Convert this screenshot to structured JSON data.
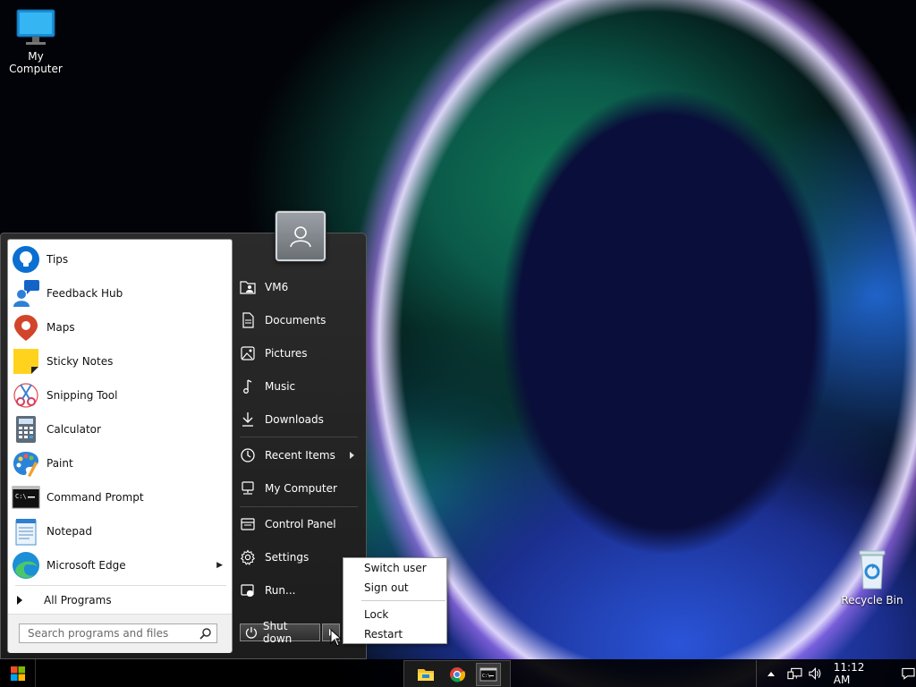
{
  "desktop": {
    "icons": [
      {
        "label": "My Computer"
      },
      {
        "label": "Recycle Bin"
      }
    ]
  },
  "start_menu": {
    "apps": [
      {
        "label": "Tips",
        "icon": "lightbulb-icon"
      },
      {
        "label": "Feedback Hub",
        "icon": "feedback-hub-icon"
      },
      {
        "label": "Maps",
        "icon": "map-pin-icon"
      },
      {
        "label": "Sticky Notes",
        "icon": "sticky-note-icon"
      },
      {
        "label": "Snipping Tool",
        "icon": "scissors-icon"
      },
      {
        "label": "Calculator",
        "icon": "calculator-icon"
      },
      {
        "label": "Paint",
        "icon": "paint-palette-icon"
      },
      {
        "label": "Command Prompt",
        "icon": "terminal-icon"
      },
      {
        "label": "Notepad",
        "icon": "notepad-icon"
      },
      {
        "label": "Microsoft Edge",
        "icon": "edge-browser-icon"
      }
    ],
    "all_programs": "All Programs",
    "search": {
      "placeholder": "Search programs and files"
    },
    "right_items": [
      {
        "label": "VM6",
        "icon": "user-folder-icon"
      },
      {
        "label": "Documents",
        "icon": "document-icon"
      },
      {
        "label": "Pictures",
        "icon": "picture-icon"
      },
      {
        "label": "Music",
        "icon": "music-note-icon"
      },
      {
        "label": "Downloads",
        "icon": "download-icon"
      },
      {
        "label": "Recent Items",
        "icon": "clock-icon"
      },
      {
        "label": "My Computer",
        "icon": "computer-icon"
      },
      {
        "label": "Control Panel",
        "icon": "control-panel-icon"
      },
      {
        "label": "Settings",
        "icon": "gear-icon"
      },
      {
        "label": "Run...",
        "icon": "run-icon"
      }
    ],
    "shutdown_label": "Shut down"
  },
  "power_menu": {
    "items": [
      "Switch user",
      "Sign out",
      "Lock",
      "Restart"
    ]
  },
  "taskbar": {
    "clock": "11:12 AM"
  },
  "colors": {
    "menu_bg": "#1c1c1c",
    "accent_blue": "#0078d4",
    "taskbar_bg": "#000000"
  }
}
